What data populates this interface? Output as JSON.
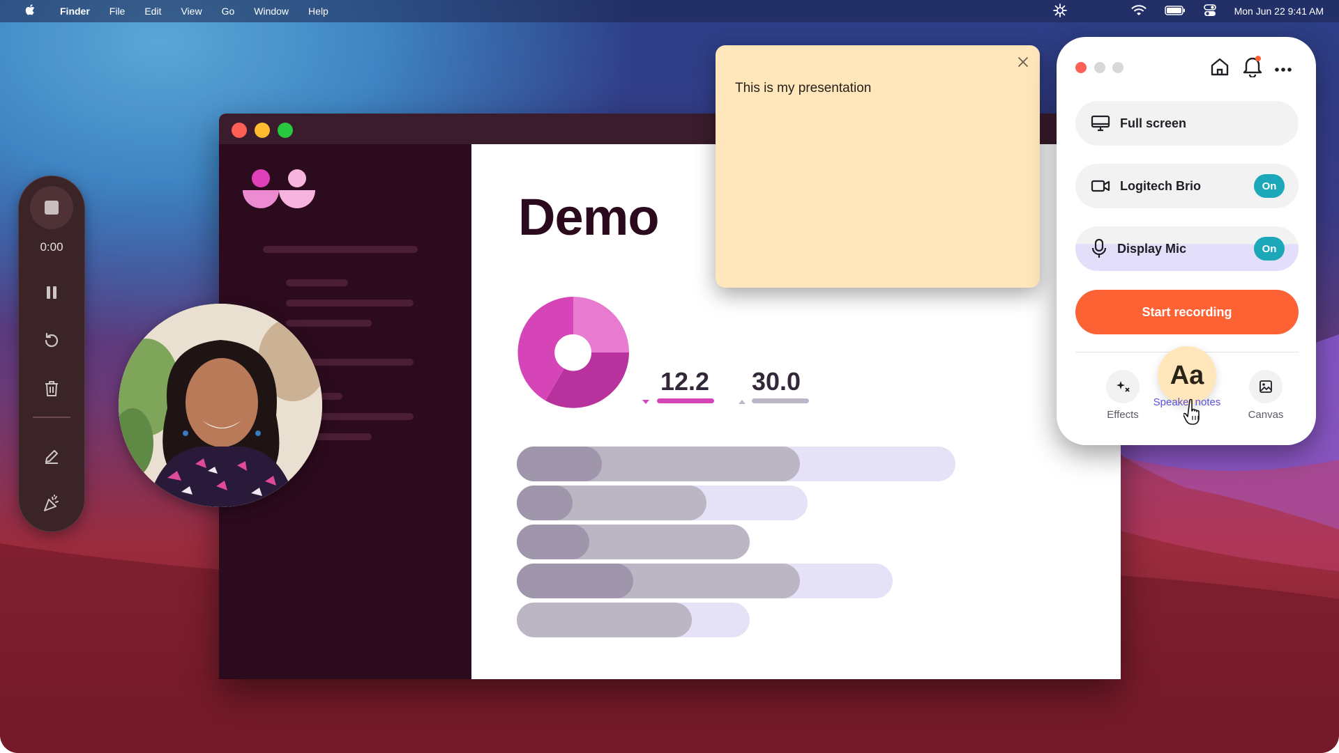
{
  "menubar": {
    "app_name": "Finder",
    "items": [
      "File",
      "Edit",
      "View",
      "Go",
      "Window",
      "Help"
    ],
    "clock": "Mon Jun 22  9:41 AM"
  },
  "recorder": {
    "timer": "0:00"
  },
  "slide": {
    "title": "Demo",
    "stat1": "12.2",
    "stat2": "30.0",
    "accent": "#d645b8"
  },
  "note": {
    "text": "This is my presentation"
  },
  "panel": {
    "fullscreen_label": "Full screen",
    "camera_label": "Logitech Brio",
    "camera_toggle": "On",
    "mic_label": "Display Mic",
    "mic_toggle": "On",
    "record_button": "Start recording",
    "record_color": "#fd6234",
    "tabs": {
      "effects": "Effects",
      "speaker_notes": "Speaker notes",
      "speaker_notes_glyph": "Aa",
      "canvas": "Canvas"
    }
  }
}
